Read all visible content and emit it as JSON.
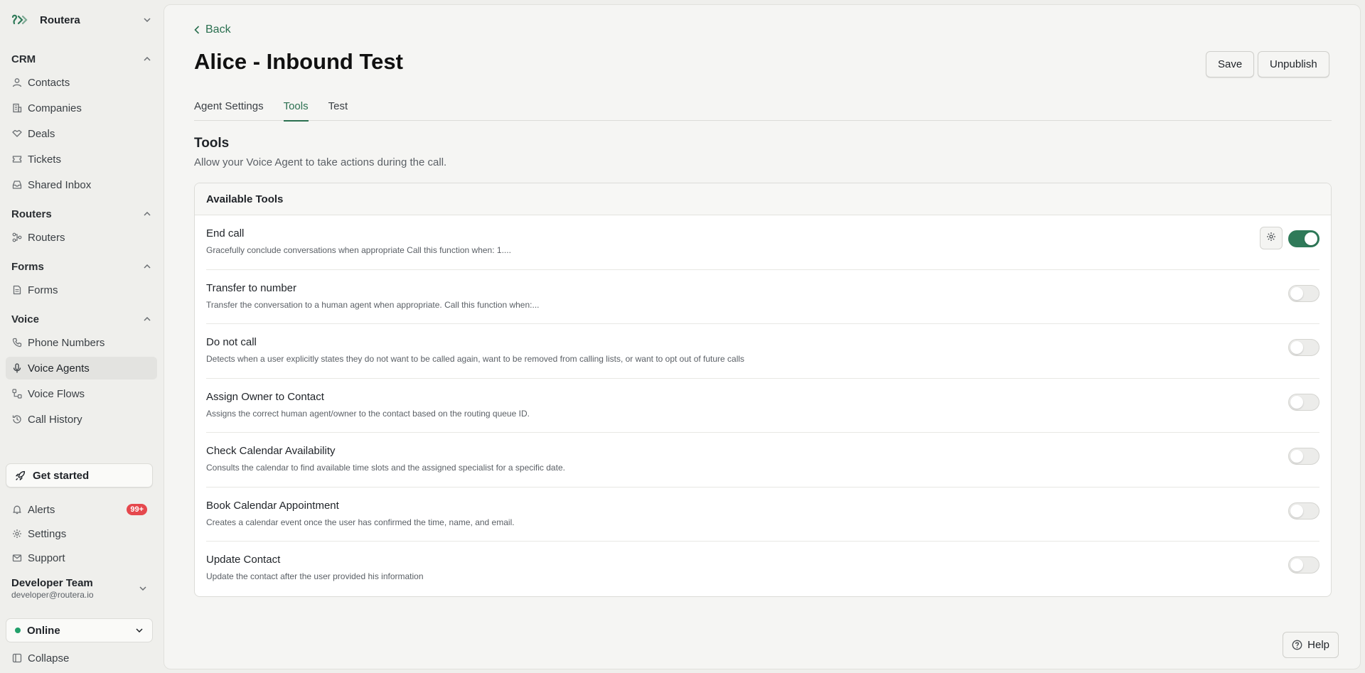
{
  "app": {
    "name": "Routera"
  },
  "sidebar": {
    "sections": {
      "crm": {
        "label": "CRM",
        "items": [
          "Contacts",
          "Companies",
          "Deals",
          "Tickets",
          "Shared Inbox"
        ]
      },
      "routers": {
        "label": "Routers",
        "items": [
          "Routers"
        ]
      },
      "forms": {
        "label": "Forms",
        "items": [
          "Forms"
        ]
      },
      "voice": {
        "label": "Voice",
        "items": [
          "Phone Numbers",
          "Voice Agents",
          "Voice Flows",
          "Call History"
        ]
      }
    },
    "active_item": "Voice Agents",
    "get_started": "Get started",
    "alerts": {
      "label": "Alerts",
      "badge": "99+"
    },
    "settings": "Settings",
    "support": "Support",
    "team": {
      "name": "Developer Team",
      "email": "developer@routera.io"
    },
    "status": {
      "label": "Online",
      "color": "#22a06b"
    },
    "collapse": "Collapse"
  },
  "header": {
    "back": "Back",
    "title": "Alice - Inbound Test",
    "save": "Save",
    "unpublish": "Unpublish"
  },
  "tabs": [
    "Agent Settings",
    "Tools",
    "Test"
  ],
  "active_tab": "Tools",
  "tools_section": {
    "title": "Tools",
    "description": "Allow your Voice Agent to take actions during the call.",
    "card_title": "Available Tools",
    "tools": [
      {
        "name": "End call",
        "description": "Gracefully conclude conversations when appropriate Call this function when: 1....",
        "enabled": true
      },
      {
        "name": "Transfer to number",
        "description": "Transfer the conversation to a human agent when appropriate. Call this function when:...",
        "enabled": false
      },
      {
        "name": "Do not call",
        "description": "Detects when a user explicitly states they do not want to be called again, want to be removed from calling lists, or want to opt out of future calls",
        "enabled": false
      },
      {
        "name": "Assign Owner to Contact",
        "description": "Assigns the correct human agent/owner to the contact based on the routing queue ID.",
        "enabled": false
      },
      {
        "name": "Check Calendar Availability",
        "description": "Consults the calendar to find available time slots and the assigned specialist for a specific date.",
        "enabled": false
      },
      {
        "name": "Book Calendar Appointment",
        "description": "Creates a calendar event once the user has confirmed the time, name, and email.",
        "enabled": false
      },
      {
        "name": "Update Contact",
        "description": "Update the contact after the user provided his information",
        "enabled": false
      }
    ]
  },
  "help": "Help",
  "colors": {
    "accent": "#2a6f4f",
    "toggle_on": "#2f7a59",
    "badge": "#e5484d"
  }
}
